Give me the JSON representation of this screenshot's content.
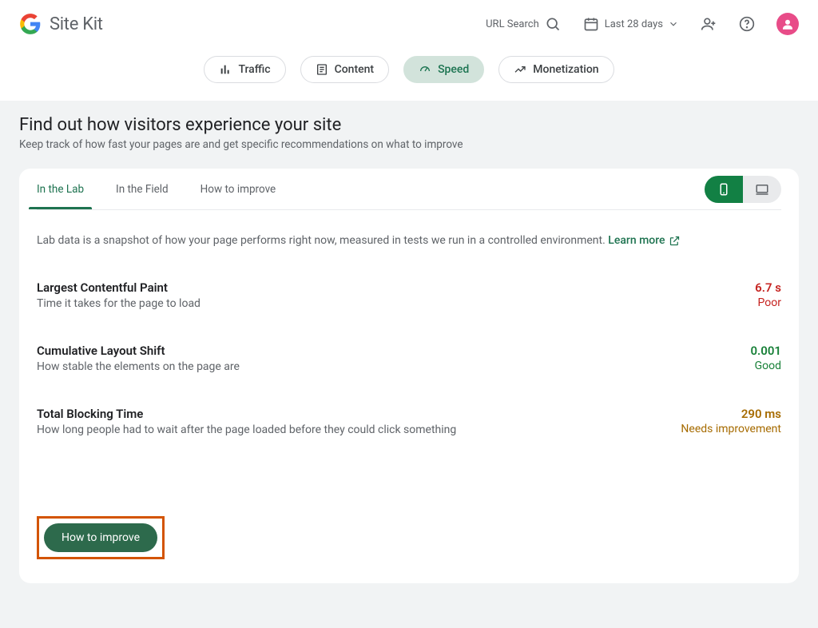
{
  "header": {
    "brand": "Site Kit",
    "url_search_label": "URL Search",
    "date_range_label": "Last 28 days"
  },
  "nav": {
    "traffic": "Traffic",
    "content": "Content",
    "speed": "Speed",
    "monetization": "Monetization"
  },
  "page": {
    "title": "Find out how visitors experience your site",
    "subtitle": "Keep track of how fast your pages are and get specific recommendations on what to improve"
  },
  "tabs": {
    "lab": "In the Lab",
    "field": "In the Field",
    "howto": "How to improve"
  },
  "lab_note_prefix": "Lab data is a snapshot of how your page performs right now, measured in tests we run in a controlled environment. ",
  "lab_note_link": "Learn more",
  "metrics": [
    {
      "title": "Largest Contentful Paint",
      "desc": "Time it takes for the page to load",
      "value": "6.7 s",
      "rating": "Poor",
      "rating_class": "poor"
    },
    {
      "title": "Cumulative Layout Shift",
      "desc": "How stable the elements on the page are",
      "value": "0.001",
      "rating": "Good",
      "rating_class": "good"
    },
    {
      "title": "Total Blocking Time",
      "desc": "How long people had to wait after the page loaded before they could click something",
      "value": "290 ms",
      "rating": "Needs improvement",
      "rating_class": "needs"
    }
  ],
  "cta": {
    "label": "How to improve"
  },
  "colors": {
    "brand_green": "#1e7350",
    "poor": "#c5221f",
    "good": "#188038",
    "needs": "#a66b00",
    "highlight_border": "#d35400"
  }
}
